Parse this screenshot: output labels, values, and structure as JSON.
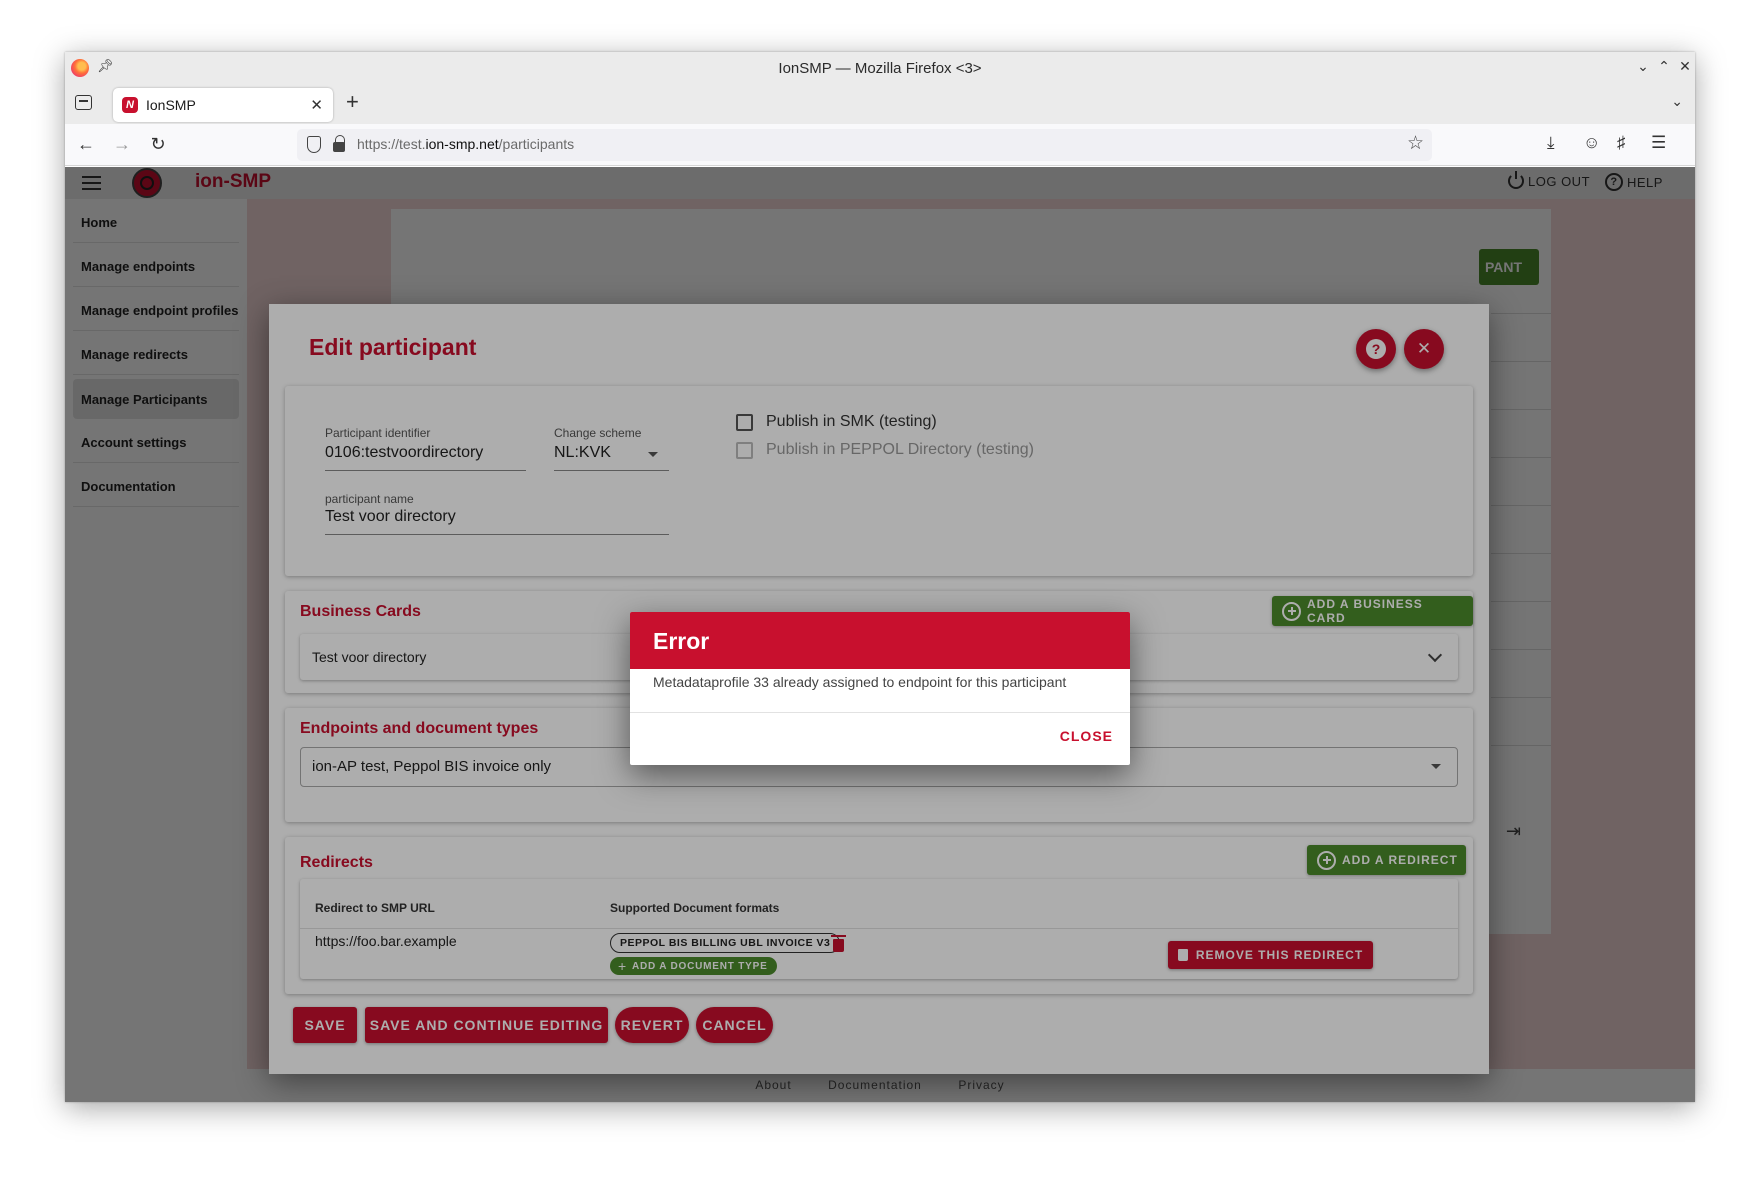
{
  "browser": {
    "window_title": "IonSMP — Mozilla Firefox <3>",
    "tab_title": "IonSMP",
    "url_prefix": "https://test.",
    "url_host": "ion-smp.net",
    "url_path": "/participants"
  },
  "app": {
    "name": "ion-SMP",
    "logout_label": "LOG OUT",
    "help_label": "HELP"
  },
  "sidebar": {
    "items": [
      {
        "label": "Home"
      },
      {
        "label": "Manage endpoints"
      },
      {
        "label": "Manage endpoint profiles"
      },
      {
        "label": "Manage redirects"
      },
      {
        "label": "Manage Participants"
      },
      {
        "label": "Account settings"
      },
      {
        "label": "Documentation"
      }
    ],
    "active_index": 4
  },
  "background": {
    "button_fragment": "PANT"
  },
  "footer": {
    "links": [
      "About",
      "Documentation",
      "Privacy"
    ]
  },
  "edit_dialog": {
    "title": "Edit participant",
    "participant_identifier_label": "Participant identifier",
    "participant_identifier_value": "0106:testvoordirectory",
    "change_scheme_label": "Change scheme",
    "change_scheme_value": "NL:KVK",
    "participant_name_label": "participant name",
    "participant_name_value": "Test voor directory",
    "publish_smk_label": "Publish in SMK (testing)",
    "publish_smk_checked": false,
    "publish_peppol_label": "Publish in PEPPOL Directory (testing)",
    "publish_peppol_checked": false,
    "business_cards": {
      "title": "Business Cards",
      "add_button": "ADD A BUSINESS CARD",
      "items": [
        {
          "name": "Test voor directory"
        }
      ]
    },
    "endpoints": {
      "title": "Endpoints and document types",
      "selected": "ion-AP test, Peppol BIS invoice only"
    },
    "redirects": {
      "title": "Redirects",
      "add_button": "ADD A REDIRECT",
      "col_url": "Redirect to SMP URL",
      "col_formats": "Supported Document formats",
      "rows": [
        {
          "url": "https://foo.bar.example",
          "formats": [
            "PEPPOL BIS BILLING UBL INVOICE V3"
          ],
          "add_doc_type": "ADD A DOCUMENT TYPE",
          "remove_label": "REMOVE THIS REDIRECT"
        }
      ]
    },
    "actions": {
      "save": "SAVE",
      "save_continue": "SAVE AND CONTINUE EDITING",
      "revert": "REVERT",
      "cancel": "CANCEL"
    }
  },
  "error_dialog": {
    "title": "Error",
    "message": "Metadataprofile 33 already assigned to endpoint for this participant",
    "close_label": "CLOSE"
  },
  "colors": {
    "brand_red": "#c8102e",
    "green": "#4c8b2b",
    "content_background": "#f4d7d7"
  }
}
